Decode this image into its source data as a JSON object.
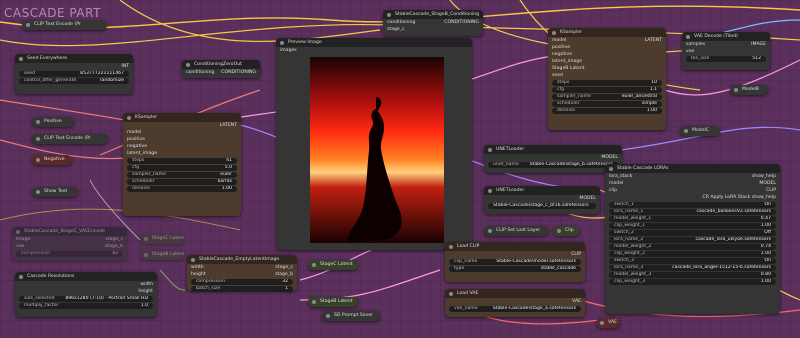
{
  "group": {
    "title": "CASCADE PART"
  },
  "nodes": {
    "clip_top": {
      "title": "CLIP Text Encode (Pr"
    },
    "seed": {
      "title": "Seed Everywhere",
      "out": "INT",
      "seed_label": "seed",
      "seed_value": "853777221111467",
      "control_label": "control_after_generate",
      "control_value": "randomize"
    },
    "positive": {
      "title": "Positive"
    },
    "clip_mid": {
      "title": "CLIP Text Encode (Pr"
    },
    "negative": {
      "title": "Negative"
    },
    "show_text": {
      "title": "Show Text"
    },
    "cond_zero": {
      "title": "ConditioningZeroOut",
      "in": "conditioning",
      "out": "CONDITIONING"
    },
    "stageb_cond": {
      "title": "StableCascade_StageB_Conditioning",
      "in1": "conditioning",
      "in2": "stage_c",
      "out": "CONDITIONING"
    },
    "preview": {
      "title": "Preview Image",
      "in": "images"
    },
    "ksampler_a": {
      "title": "KSampler",
      "out": "LATENT",
      "inputs": [
        "model",
        "positive",
        "negative",
        "latent_image"
      ],
      "widgets": [
        {
          "label": "steps",
          "value": "41"
        },
        {
          "label": "cfg",
          "value": "5.0"
        },
        {
          "label": "sampler_name",
          "value": "euler"
        },
        {
          "label": "scheduler",
          "value": "karras"
        },
        {
          "label": "denoise",
          "value": "1.00"
        }
      ]
    },
    "ksampler_b": {
      "title": "KSampler",
      "out": "LATENT",
      "inputs": [
        "model",
        "positive",
        "negative",
        "latent_image"
      ],
      "extra_inputs": [
        "StageB Latent",
        "seed"
      ],
      "widgets": [
        {
          "label": "steps",
          "value": "10"
        },
        {
          "label": "cfg",
          "value": "1.1"
        },
        {
          "label": "sampler_name",
          "value": "euler_ancestral"
        },
        {
          "label": "scheduler",
          "value": "simple"
        },
        {
          "label": "denoise",
          "value": "1.00"
        }
      ]
    },
    "vae_decode": {
      "title": "VAE Decode (Tiled)",
      "in1": "samples",
      "in2": "vae",
      "out": "IMAGE",
      "tile_label": "tile_size",
      "tile_value": "512"
    },
    "modelb": {
      "title": "ModelB"
    },
    "modelc": {
      "title": "ModelC"
    },
    "unet_b": {
      "title": "UNETLoader",
      "out": "MODEL",
      "label": "unet_name",
      "value": "Stable-Cascade\\stage_b.safetensors"
    },
    "unet_c": {
      "title": "UNETLoader",
      "out": "MODEL",
      "value": "Stable-Cascade\\stage_c_bf16.safetensors"
    },
    "clip_last": {
      "title": "CLIP Set Last Layer"
    },
    "clip_out": {
      "title": "Clip"
    },
    "loras": {
      "title": "Stable Cascade LORAs",
      "inputs": [
        "lora_stack",
        "model",
        "clip"
      ],
      "outs": [
        "show_help",
        "MODEL",
        "CLIP"
      ],
      "cr_label": "CR Apply LoRA Stack show_help",
      "widgets": [
        {
          "label": "switch_1",
          "value": "On"
        },
        {
          "label": "lora_name_1",
          "value": "cascade_balloonsV2.safetensors"
        },
        {
          "label": "model_weight_1",
          "value": "0.47"
        },
        {
          "label": "clip_weight_1",
          "value": "1.00"
        },
        {
          "label": "switch_2",
          "value": "Off"
        },
        {
          "label": "lora_name_2",
          "value": "cascade_lora_ukiyoe.safetensors"
        },
        {
          "label": "model_weight_2",
          "value": "0.74"
        },
        {
          "label": "clip_weight_2",
          "value": "1.00"
        },
        {
          "label": "switch_3",
          "value": "On"
        },
        {
          "label": "lora_name_3",
          "value": "cascade_lora_anger-1512-15-6.safetensors"
        },
        {
          "label": "model_weight_3",
          "value": "0.80"
        },
        {
          "label": "clip_weight_3",
          "value": "1.00"
        }
      ]
    },
    "stagec_vae": {
      "title": "StableCascade_StageC_VAEEncode",
      "in1": "image",
      "in2": "vae",
      "out1": "stage_c",
      "out2": "stage_b",
      "widget_label": "compression",
      "widget_value": "42"
    },
    "stagec_latent_a": {
      "title": "StageC Latent"
    },
    "stageb_latent_a": {
      "title": "StageB Latent"
    },
    "resolutions": {
      "title": "Cascade Resolutions",
      "out1": "width",
      "out2": "height",
      "widgets": [
        {
          "label": "size_selected",
          "value": "896x1280 (7:10) - Portrait Small HD"
        },
        {
          "label": "multiply_factor",
          "value": "1.0"
        }
      ]
    },
    "empty_latent": {
      "title": "StableCascade_EmptyLatentImage",
      "in1": "width",
      "in2": "height",
      "out1": "stage_c",
      "out2": "stage_b",
      "widgets": [
        {
          "label": "compression",
          "value": "32"
        },
        {
          "label": "batch_size",
          "value": "1"
        }
      ]
    },
    "stagec_latent_b": {
      "title": "StageC Latent"
    },
    "stageb_latent_b": {
      "title": "StageB Latent"
    },
    "sd_prompt_saver": {
      "title": "SD Prompt Saver"
    },
    "load_clip": {
      "title": "Load CLIP",
      "out": "CLIP",
      "widgets": [
        {
          "label": "clip_name",
          "value": "Stable-Cascade\\model.safetensors"
        },
        {
          "label": "type",
          "value": "stable_cascade"
        }
      ]
    },
    "load_vae": {
      "title": "Load VAE",
      "out": "VAE",
      "label": "vae_name",
      "value": "Stable-Cascade\\stage_a.safetensors"
    },
    "vae_out": {
      "title": "VAE"
    }
  },
  "colors": {
    "canvas": "#5b305c",
    "node": "#353535",
    "brown_node": "#4d3b2e"
  }
}
